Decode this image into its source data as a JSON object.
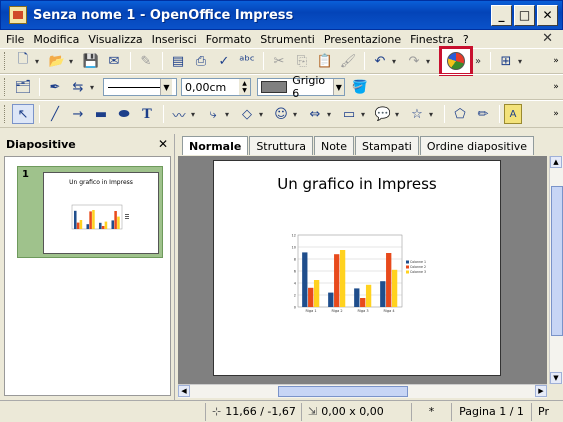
{
  "window": {
    "title": "Senza nome 1 - OpenOffice Impress",
    "min": "_",
    "max": "□",
    "close": "✕"
  },
  "menu": {
    "items": [
      "File",
      "Modifica",
      "Visualizza",
      "Inserisci",
      "Formato",
      "Strumenti",
      "Presentazione",
      "Finestra",
      "?"
    ],
    "close": "✕"
  },
  "toolbar2": {
    "line_width": "0,00cm",
    "color_name": "Grigio 6"
  },
  "panel": {
    "title": "Diapositive",
    "close": "✕",
    "slide_number": "1",
    "thumb_title": "Un grafico in Impress"
  },
  "tabs": [
    "Normale",
    "Struttura",
    "Note",
    "Stampati",
    "Ordine diapositive"
  ],
  "slide": {
    "title": "Un grafico in Impress"
  },
  "chart_data": {
    "type": "bar",
    "categories": [
      "Riga 1",
      "Riga 2",
      "Riga 3",
      "Riga 4"
    ],
    "series": [
      {
        "name": "Colonne 1",
        "values": [
          9.1,
          2.4,
          3.1,
          4.3
        ],
        "color": "#1f4e8c"
      },
      {
        "name": "Colonne 2",
        "values": [
          3.2,
          8.8,
          1.5,
          9.0
        ],
        "color": "#e84a1c"
      },
      {
        "name": "Colonne 3",
        "values": [
          4.5,
          9.5,
          3.7,
          6.2
        ],
        "color": "#ffd21f"
      }
    ],
    "ylim": [
      0,
      12
    ],
    "yticks": [
      "0",
      "2",
      "4",
      "6",
      "8",
      "10",
      "12"
    ],
    "grid": true,
    "legend": "right"
  },
  "status": {
    "position": "11,66 / -1,67",
    "size": "0,00 x 0,00",
    "modified": "*",
    "page": "Pagina 1 / 1",
    "extra": "Pr"
  },
  "colors": {
    "highlight": "#c8102e",
    "thumb_selected": "#9fc28c"
  }
}
